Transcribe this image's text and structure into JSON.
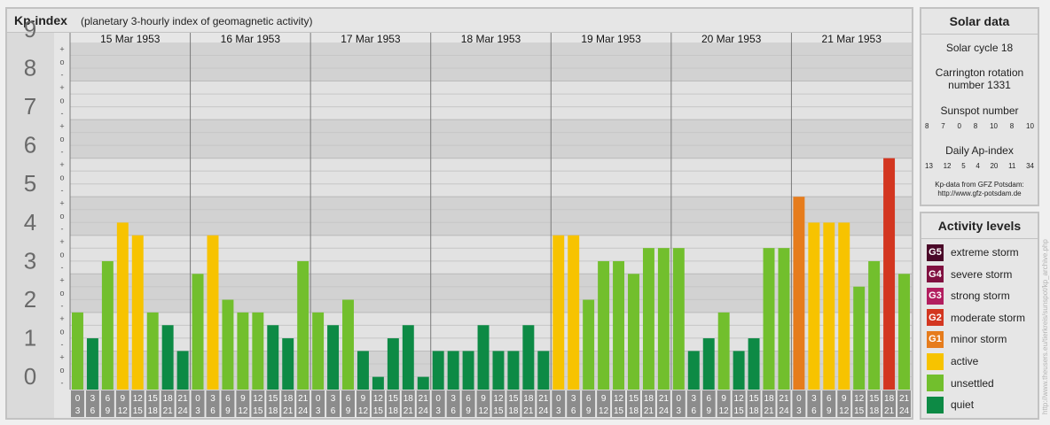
{
  "header": {
    "title": "Kp-index",
    "subtitle": "(planetary 3-hourly index of geomagnetic activity)"
  },
  "chart_data": {
    "type": "bar",
    "ylim": [
      0,
      9
    ],
    "y_ticks": [
      "0",
      "1",
      "2",
      "3",
      "4",
      "5",
      "6",
      "7",
      "8",
      "9"
    ],
    "minor_ticks": [
      "-",
      "o",
      "+"
    ],
    "days": [
      "15 Mar 1953",
      "16 Mar 1953",
      "17 Mar 1953",
      "18 Mar 1953",
      "19 Mar 1953",
      "20 Mar 1953",
      "21 Mar 1953"
    ],
    "interval_labels": [
      [
        "0",
        "3"
      ],
      [
        "3",
        "6"
      ],
      [
        "6",
        "9"
      ],
      [
        "9",
        "12"
      ],
      [
        "12",
        "15"
      ],
      [
        "15",
        "18"
      ],
      [
        "18",
        "21"
      ],
      [
        "21",
        "24"
      ]
    ],
    "values": [
      [
        2.0,
        1.33,
        3.33,
        4.33,
        4.0,
        2.0,
        1.67,
        1.0
      ],
      [
        3.0,
        4.0,
        2.33,
        2.0,
        2.0,
        1.67,
        1.33,
        3.33
      ],
      [
        2.0,
        1.67,
        2.33,
        1.0,
        0.33,
        1.33,
        1.67,
        0.33
      ],
      [
        1.0,
        1.0,
        1.0,
        1.67,
        1.0,
        1.0,
        1.67,
        1.0
      ],
      [
        4.0,
        4.0,
        2.33,
        3.33,
        3.33,
        3.0,
        3.67,
        3.67
      ],
      [
        3.67,
        1.0,
        1.33,
        2.0,
        1.0,
        1.33,
        3.67,
        3.67
      ],
      [
        5.0,
        4.33,
        4.33,
        4.33,
        2.67,
        3.33,
        6.0,
        3.0
      ]
    ],
    "colors": {
      "quiet": "#0d8a45",
      "unsettled": "#72bf2d",
      "active": "#f7c300",
      "minor_storm": "#e67c1c",
      "moderate_storm": "#d33620",
      "strong_storm": "#b21e5f",
      "severe_storm": "#801040",
      "extreme_storm": "#4a0828"
    }
  },
  "solar": {
    "title": "Solar data",
    "cycle": "Solar cycle 18",
    "carrington": "Carrington rotation number 1331",
    "sunspot_title": "Sunspot number",
    "sunspot_values": [
      "8",
      "7",
      "0",
      "8",
      "10",
      "8",
      "10"
    ],
    "ap_title": "Daily Ap-index",
    "ap_values": [
      "13",
      "12",
      "5",
      "4",
      "20",
      "11",
      "34"
    ],
    "source_line1": "Kp-data from GFZ Potsdam:",
    "source_line2": "http://www.gfz-potsdam.de"
  },
  "levels": {
    "title": "Activity levels",
    "items": [
      {
        "code": "G5",
        "label": "extreme storm",
        "color": "#4a0828"
      },
      {
        "code": "G4",
        "label": "severe storm",
        "color": "#801040"
      },
      {
        "code": "G3",
        "label": "strong storm",
        "color": "#b21e5f"
      },
      {
        "code": "G2",
        "label": "moderate storm",
        "color": "#d33620"
      },
      {
        "code": "G1",
        "label": "minor storm",
        "color": "#e67c1c"
      },
      {
        "code": "",
        "label": "active",
        "color": "#f7c300"
      },
      {
        "code": "",
        "label": "unsettled",
        "color": "#72bf2d"
      },
      {
        "code": "",
        "label": "quiet",
        "color": "#0d8a45"
      }
    ]
  },
  "watermark": "http://www.theusers.eu/tierkreis/sunspot/kp_archive.php"
}
